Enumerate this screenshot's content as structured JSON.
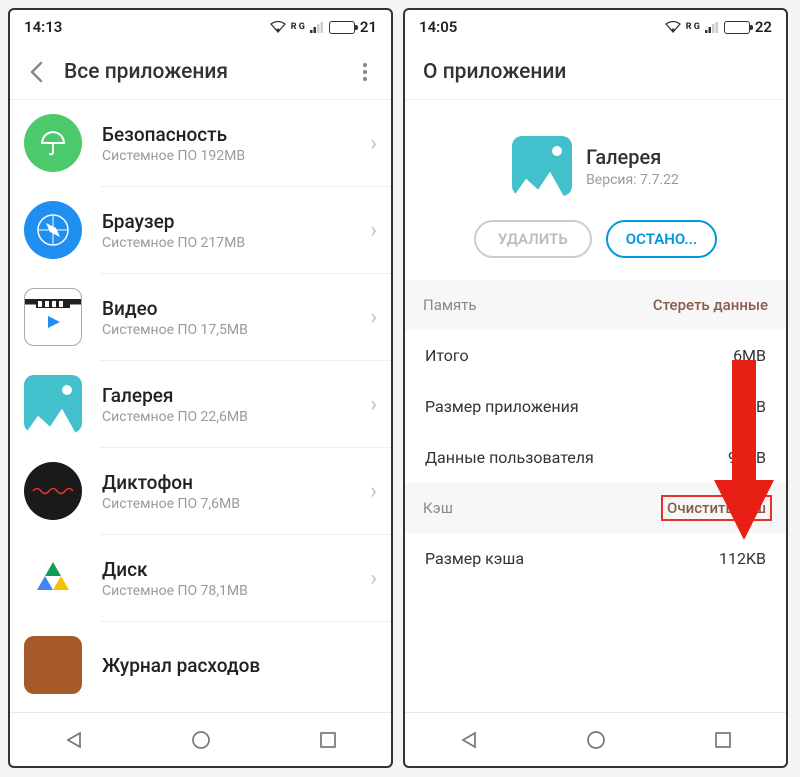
{
  "left": {
    "status": {
      "time": "14:13",
      "battery": "21",
      "network": "R G"
    },
    "header": {
      "title": "Все приложения"
    },
    "apps": [
      {
        "name": "Безопасность",
        "sub": "Системное ПО   192MB",
        "icon": "security"
      },
      {
        "name": "Браузер",
        "sub": "Системное ПО   217MB",
        "icon": "browser"
      },
      {
        "name": "Видео",
        "sub": "Системное ПО   17,5MB",
        "icon": "video"
      },
      {
        "name": "Галерея",
        "sub": "Системное ПО   22,6MB",
        "icon": "gallery"
      },
      {
        "name": "Диктофон",
        "sub": "Системное ПО   7,6MB",
        "icon": "dictaphone"
      },
      {
        "name": "Диск",
        "sub": "Системное ПО   78,1MB",
        "icon": "disk"
      },
      {
        "name": "Журнал расходов",
        "sub": "",
        "icon": "wallet"
      }
    ]
  },
  "right": {
    "status": {
      "time": "14:05",
      "battery": "22",
      "network": "R G"
    },
    "header": {
      "title": "О приложении"
    },
    "app": {
      "name": "Галерея",
      "version": "Версия: 7.7.22"
    },
    "buttons": {
      "remove": "УДАЛИТЬ",
      "stop": "ОСТАНО..."
    },
    "memory": {
      "label": "Память",
      "action": "Стереть данные",
      "rows": [
        {
          "label": "Итого",
          "value": "6MB"
        },
        {
          "label": "Размер приложения",
          "value": "MB"
        },
        {
          "label": "Данные пользователя",
          "value": "96KB"
        }
      ]
    },
    "cache": {
      "label": "Кэш",
      "action": "Очистить кэш",
      "rows": [
        {
          "label": "Размер кэша",
          "value": "112KB"
        }
      ]
    }
  }
}
